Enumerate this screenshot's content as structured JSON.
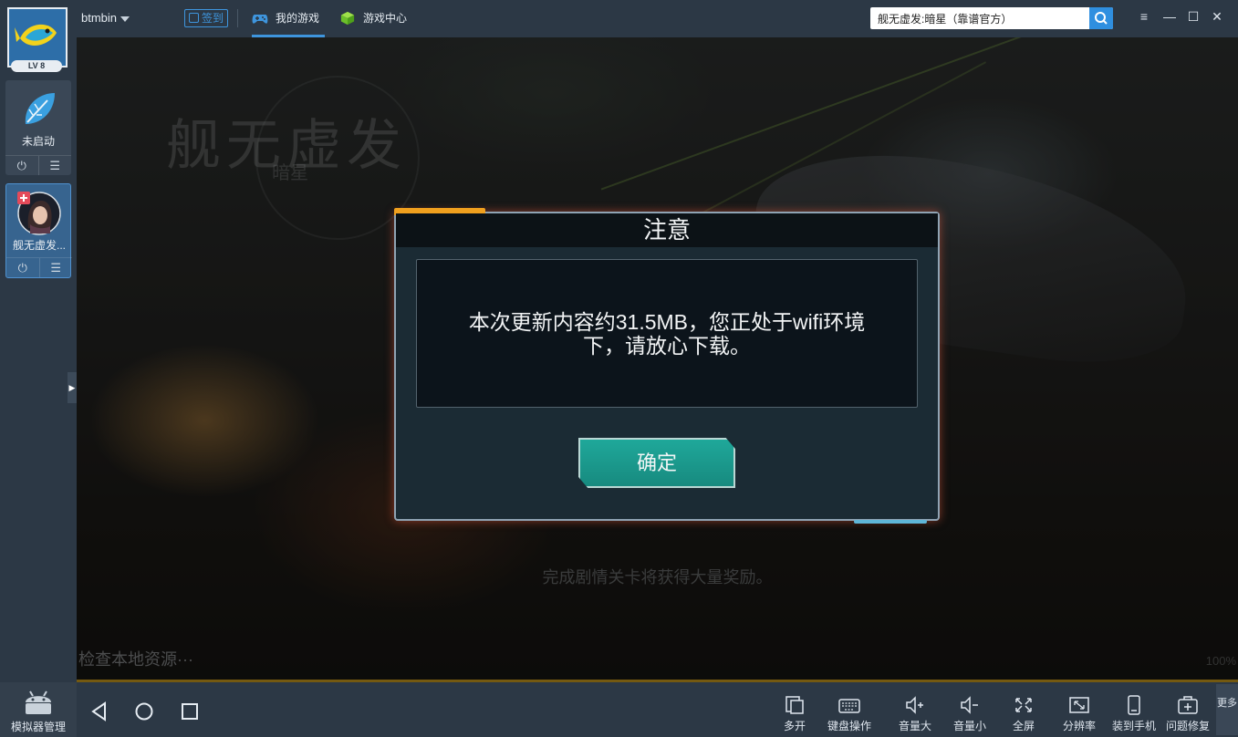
{
  "sidebar": {
    "level_badge": "LV 8",
    "instances": [
      {
        "label": "未启动",
        "power_icon": "power-icon",
        "menu_icon": "menu-icon"
      },
      {
        "label": "舰无虚发...",
        "power_icon": "power-icon",
        "menu_icon": "menu-icon"
      }
    ],
    "sim_manager_label": "模拟器管理"
  },
  "topbar": {
    "username": "btmbin",
    "checkin_label": "签到",
    "tabs": [
      {
        "label": "我的游戏",
        "icon": "gamepad-icon",
        "active": true
      },
      {
        "label": "游戏中心",
        "icon": "cube-icon",
        "active": false
      }
    ],
    "search_value": "舰无虚发:暗星（靠谱官方）",
    "window_controls": [
      "≡",
      "—",
      "☐",
      "✕"
    ]
  },
  "game": {
    "logo_title": "舰无虚发",
    "logo_subtitle": "暗星",
    "tip": "完成剧情关卡将获得大量奖励。",
    "progress_text": "检查本地资源···",
    "progress_pct": "100%",
    "progress_value": 1.0
  },
  "dialog": {
    "title": "注意",
    "message": "本次更新内容约31.5MB，您正处于wifi环境下，请放心下载。",
    "ok_label": "确定"
  },
  "bottombar": {
    "nav": [
      "back-icon",
      "home-icon",
      "recents-icon"
    ],
    "tools": [
      {
        "label": "多开",
        "icon": "multi-window-icon"
      },
      {
        "label": "键盘操作",
        "icon": "keyboard-icon"
      },
      {
        "label": "音量大",
        "icon": "volume-up-icon"
      },
      {
        "label": "音量小",
        "icon": "volume-down-icon"
      },
      {
        "label": "全屏",
        "icon": "fullscreen-icon"
      },
      {
        "label": "分辨率",
        "icon": "resolution-icon"
      },
      {
        "label": "装到手机",
        "icon": "phone-install-icon"
      },
      {
        "label": "问题修复",
        "icon": "repair-kit-icon"
      }
    ],
    "more_label": "更多"
  },
  "colors": {
    "accent_blue": "#3e95dd",
    "dialog_button": "#1fa89a",
    "dialog_accent": "#f0a01e"
  }
}
